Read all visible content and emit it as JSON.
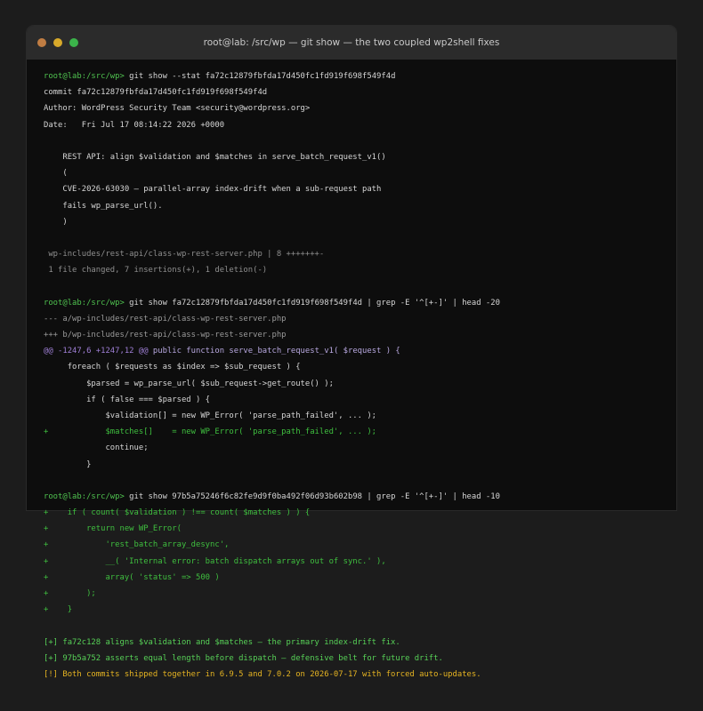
{
  "window": {
    "title": "root@lab: /src/wp  —  git show  —  the two coupled wp2shell fixes"
  },
  "prompt": "root@lab:/src/wp>",
  "cmd1": " git show --stat fa72c12879fbfda17d450fc1fd919f698f549f4d",
  "commit": "commit fa72c12879fbfda17d450fc1fd919f698f549f4d",
  "author": "Author: WordPress Security Team <security@wordpress.org>",
  "date": "Date:   Fri Jul 17 08:14:22 2026 +0000",
  "msg1": "    REST API: align $validation and $matches in serve_batch_request_v1()",
  "msg2": "    (",
  "msg3": "    CVE-2026-63030 — parallel-array index-drift when a sub-request path",
  "msg4": "    fails wp_parse_url().",
  "msg5": "    )",
  "stat1": " wp-includes/rest-api/class-wp-rest-server.php | 8 +++++++-",
  "stat2": " 1 file changed, 7 insertions(+), 1 deletion(-)",
  "cmd2": " git show fa72c12879fbfda17d450fc1fd919f698f549f4d | grep -E '^[+-]' | head -20",
  "diff_a": "--- a/wp-includes/rest-api/class-wp-rest-server.php",
  "diff_b": "+++ b/wp-includes/rest-api/class-wp-rest-server.php",
  "hunk_at": "@@ -1247,6 +1247,12 @@",
  "hunk_fn": " public function serve_batch_request_v1( $request ) {",
  "code1": "     foreach ( $requests as $index => $sub_request ) {",
  "code2": "         $parsed = wp_parse_url( $sub_request->get_route() );",
  "code3": "         if ( false === $parsed ) {",
  "code4": "             $validation[] = new WP_Error( 'parse_path_failed', ... );",
  "code5": "+            $matches[]    = new WP_Error( 'parse_path_failed', ... );",
  "code6": "             continue;",
  "code7": "         }",
  "cmd3": " git show 97b5a75246f6c82fe9d9f0ba492f06d93b602b98 | grep -E '^[+-]' | head -10",
  "add1": "+    if ( count( $validation ) !== count( $matches ) ) {",
  "add2": "+        return new WP_Error(",
  "add3": "+            'rest_batch_array_desync',",
  "add4": "+            __( 'Internal error: batch dispatch arrays out of sync.' ),",
  "add5": "+            array( 'status' => 500 )",
  "add6": "+        );",
  "add7": "+    }",
  "sum1": "[+] fa72c128 aligns $validation and $matches — the primary index-drift fix.",
  "sum2": "[+] 97b5a752 asserts equal length before dispatch — defensive belt for future drift.",
  "sum3": "[!] Both commits shipped together in 6.9.5 and 7.0.2 on 2026-07-17 with forced auto-updates."
}
